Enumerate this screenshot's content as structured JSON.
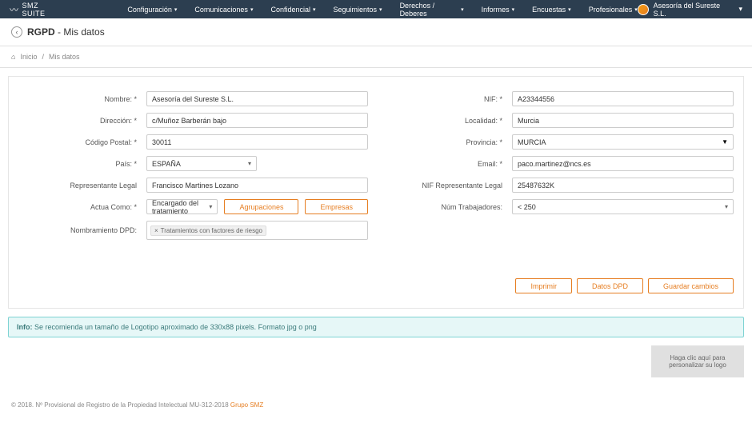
{
  "header": {
    "logo_text": "SMZ SUITE",
    "menu": [
      "Configuración",
      "Comunicaciones",
      "Confidencial",
      "Seguimientos",
      "Derechos / Deberes",
      "Informes",
      "Encuestas",
      "Profesionales"
    ],
    "account_name": "Asesoría del Sureste S.L."
  },
  "page": {
    "title_strong": "RGPD",
    "title_rest": " - Mis datos"
  },
  "breadcrumb": {
    "home": "Inicio",
    "sep": "/",
    "current": "Mis datos"
  },
  "form": {
    "left": {
      "nombre_label": "Nombre: *",
      "nombre_value": "Asesoría del Sureste S.L.",
      "direccion_label": "Dirección: *",
      "direccion_value": "c/Muñoz Barberán bajo",
      "cp_label": "Código Postal: *",
      "cp_value": "30011",
      "pais_label": "País: *",
      "pais_value": "ESPAÑA",
      "rep_label": "Representante Legal",
      "rep_value": "Francisco Martines Lozano",
      "actua_label": "Actua Como: *",
      "actua_value": "Encargado del tratamiento",
      "agrupaciones_btn": "Agrupaciones",
      "empresas_btn": "Empresas",
      "dpd_label": "Nombramiento DPD:",
      "dpd_tag": "Tratamientos con factores de riesgo"
    },
    "right": {
      "nif_label": "NIF: *",
      "nif_value": "A23344556",
      "localidad_label": "Localidad: *",
      "localidad_value": "Murcia",
      "provincia_label": "Provincia: *",
      "provincia_value": "MURCIA",
      "email_label": "Email: *",
      "email_value": "paco.martinez@ncs.es",
      "nifrep_label": "NIF Representante Legal",
      "nifrep_value": "25487632K",
      "numtrab_label": "Núm Trabajadores:",
      "numtrab_value": "< 250"
    }
  },
  "actions": {
    "imprimir": "Imprimir",
    "datos_dpd": "Datos DPD",
    "guardar": "Guardar cambios"
  },
  "info_alert": {
    "prefix": "Info:",
    "text": " Se recomienda un tamaño de Logotipo aproximado de 330x88 pixels. Formato jpg o png"
  },
  "logo_zone": "Haga clic aquí para personalizar su logo",
  "footer": {
    "text": "© 2018. Nº Provisional de Registro de la Propiedad Intelectual MU-312-2018 ",
    "link": "Grupo SMZ"
  }
}
